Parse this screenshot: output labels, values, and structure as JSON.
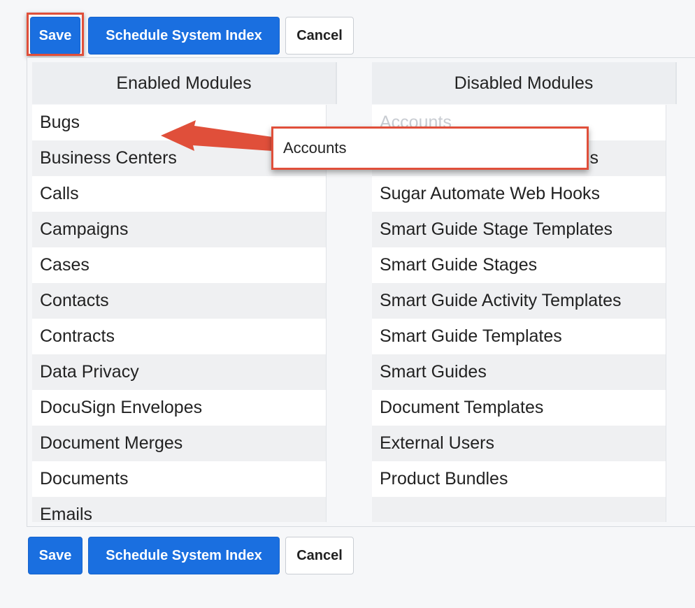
{
  "toolbar": {
    "save_label": "Save",
    "schedule_label": "Schedule System Index",
    "cancel_label": "Cancel"
  },
  "enabled": {
    "header": "Enabled Modules",
    "items": [
      "Bugs",
      "Business Centers",
      "Calls",
      "Campaigns",
      "Cases",
      "Contacts",
      "Contracts",
      "Data Privacy",
      "DocuSign Envelopes",
      "Document Merges",
      "Documents",
      "Emails"
    ]
  },
  "disabled": {
    "header": "Disabled Modules",
    "items": [
      "Accounts",
      "s",
      "Sugar Automate Web Hooks",
      "Smart Guide Stage Templates",
      "Smart Guide Stages",
      "Smart Guide Activity Templates",
      "Smart Guide Templates",
      "Smart Guides",
      "Document Templates",
      "External Users",
      "Product Bundles",
      ""
    ]
  },
  "drag": {
    "label": "Accounts"
  },
  "colors": {
    "primary": "#1a6fe0",
    "annotation": "#e04f3a"
  }
}
